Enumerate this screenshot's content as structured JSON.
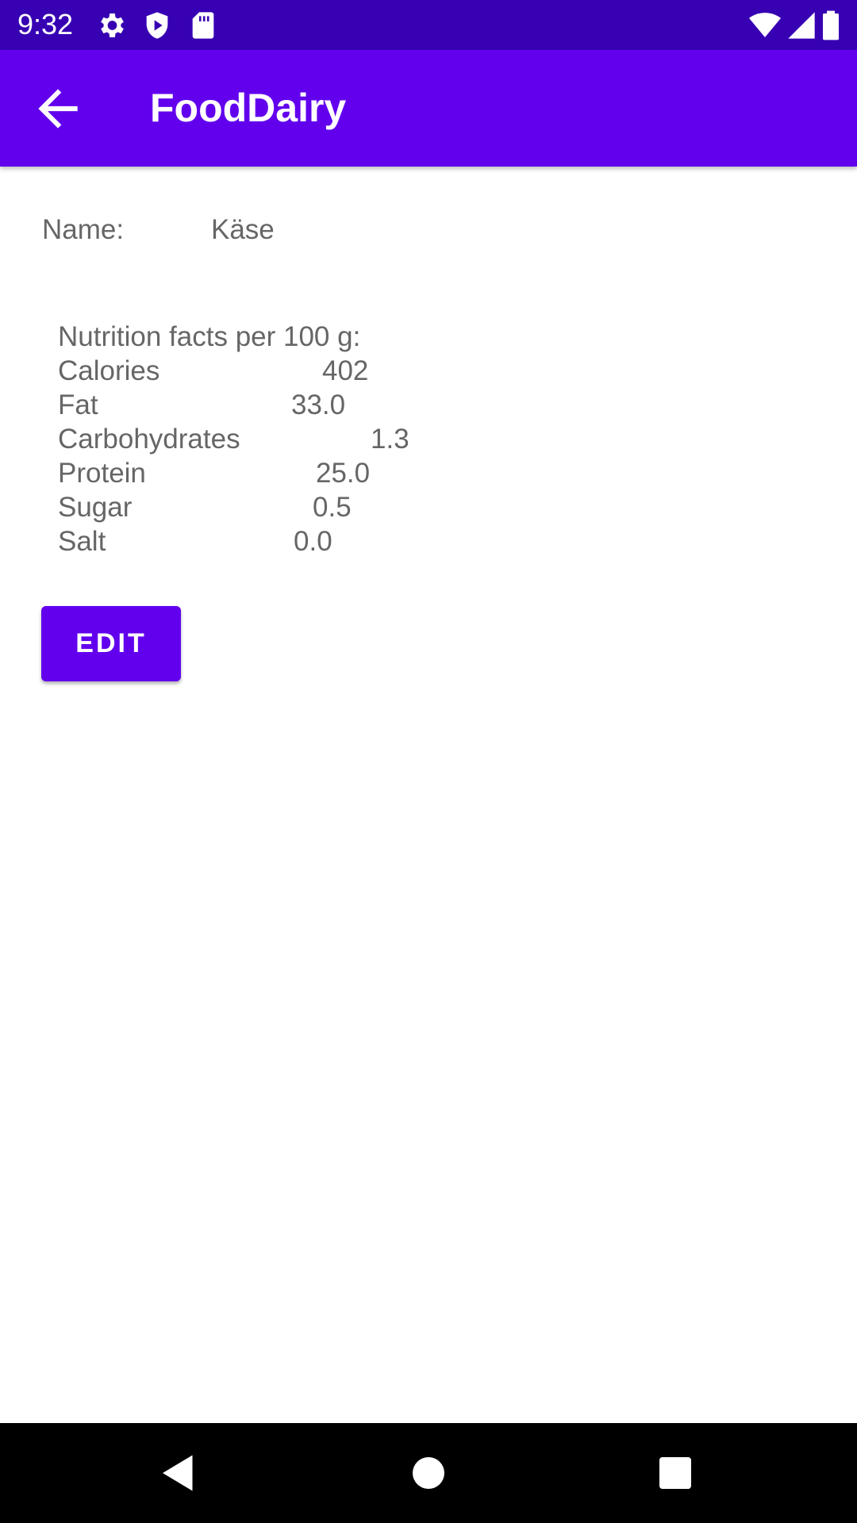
{
  "status_bar": {
    "time": "9:32",
    "icons": [
      "gear-icon",
      "shield-play-icon",
      "sd-card-icon",
      "wifi-icon",
      "signal-icon",
      "battery-icon"
    ],
    "background": "#3700b3"
  },
  "app_bar": {
    "title": "FoodDairy",
    "background": "#6200ee"
  },
  "detail": {
    "name_label": "Name:",
    "name_value": "Käse",
    "nutrition_header": "Nutrition facts per 100 g:",
    "nutrients": [
      {
        "label": "Calories",
        "value": "402"
      },
      {
        "label": "Fat",
        "value": "33.0"
      },
      {
        "label": "Carbohydrates",
        "value": "1.3"
      },
      {
        "label": "Protein",
        "value": "25.0"
      },
      {
        "label": "Sugar",
        "value": "0.5"
      },
      {
        "label": "Salt",
        "value": "0.0"
      }
    ]
  },
  "actions": {
    "edit_label": "EDIT"
  },
  "nav_bar": {
    "buttons": [
      "back-triangle-icon",
      "home-circle-icon",
      "recents-square-icon"
    ]
  }
}
